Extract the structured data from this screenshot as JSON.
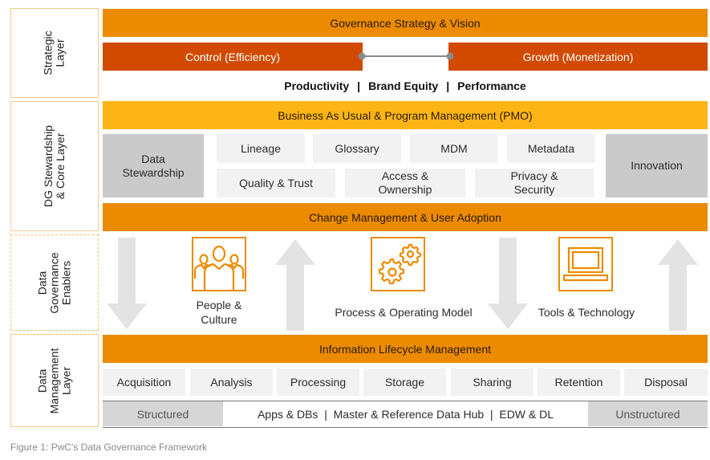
{
  "layers": {
    "strategic": "Strategic\nLayer",
    "core": "DG Stewardship\n& Core Layer",
    "enablers": "Data\nGovernance\nEnablers",
    "data_management": "Data\nManagement\nLayer"
  },
  "strategic": {
    "title": "Governance Strategy & Vision",
    "control": "Control (Efficiency)",
    "growth": "Growth (Monetization)",
    "outcomes": [
      "Productivity",
      "Brand Equity",
      "Performance"
    ],
    "separator": "|"
  },
  "core": {
    "pmo": "Business As Usual & Program Management (PMO)",
    "stewardship": "Data\nStewardship",
    "row1": [
      "Lineage",
      "Glossary",
      "MDM",
      "Metadata"
    ],
    "row2": [
      "Quality & Trust",
      "Access &\nOwnership",
      "Privacy &\nSecurity"
    ],
    "innovation": "Innovation",
    "change": "Change Management & User Adoption"
  },
  "enablers": {
    "items": [
      {
        "label": "People &\nCulture",
        "icon": "people-icon"
      },
      {
        "label": "Process & Operating Model",
        "icon": "gears-icon"
      },
      {
        "label": "Tools & Technology",
        "icon": "laptop-icon"
      }
    ],
    "arrows": [
      "down",
      "up",
      "down",
      "up"
    ]
  },
  "data_management": {
    "ilm": "Information Lifecycle Management",
    "stages": [
      "Acquisition",
      "Analysis",
      "Processing",
      "Storage",
      "Sharing",
      "Retention",
      "Disposal"
    ],
    "structured": "Structured",
    "middle": "Apps & DBs  |  Master & Reference Data Hub  |  EDW & DL",
    "unstructured": "Unstructured"
  },
  "caption": "Figure 1: PwC's Data Governance Framework",
  "colors": {
    "orange": "#ec8b00",
    "amber": "#fdb515",
    "red": "#d24a00",
    "tile": "#f2f2f2",
    "tile_grey": "#cacaca"
  }
}
